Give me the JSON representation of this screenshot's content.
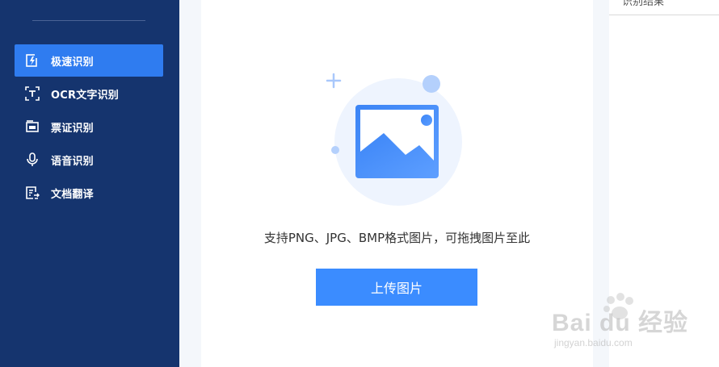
{
  "sidebar": {
    "items": [
      {
        "label": "极速识别",
        "icon": "lightning-doc-icon",
        "active": true
      },
      {
        "label": "OCR文字识别",
        "icon": "text-scan-icon",
        "active": false
      },
      {
        "label": "票证识别",
        "icon": "ticket-icon",
        "active": false
      },
      {
        "label": "语音识别",
        "icon": "microphone-icon",
        "active": false
      },
      {
        "label": "文档翻译",
        "icon": "doc-translate-icon",
        "active": false
      }
    ]
  },
  "main": {
    "hint": "支持PNG、JPG、BMP格式图片，可拖拽图片至此",
    "upload_label": "上传图片"
  },
  "result": {
    "title": "识别结果"
  },
  "watermark": {
    "brand": "Bai du 经验",
    "url": "jingyan.baidu.com"
  },
  "colors": {
    "sidebar_bg": "#15346e",
    "active_item": "#2f7cf0",
    "upload_button": "#3b8cff"
  }
}
